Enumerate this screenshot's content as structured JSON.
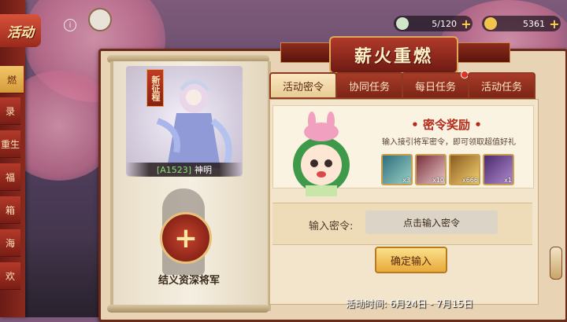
{
  "sidebar": {
    "title": "活动",
    "tabs": [
      "燃",
      "录",
      "重生",
      "福",
      "箱",
      "海",
      "欢"
    ]
  },
  "header": {
    "title": "薪火重燃",
    "info_icon": "info-icon",
    "resources": [
      {
        "value": "5/120",
        "icon": "stamina-icon",
        "color": "#cfe7c8"
      },
      {
        "value": "5361",
        "icon": "gold-ingot-icon",
        "color": "#f2c44e"
      }
    ]
  },
  "scroll": {
    "badge": "新征程",
    "hero_code": "[A1523]",
    "hero_name": "神明",
    "add_label": "结义资深将军"
  },
  "tabs": [
    {
      "label": "活动密令",
      "active": true,
      "dot": false
    },
    {
      "label": "协同任务",
      "active": false,
      "dot": false
    },
    {
      "label": "每日任务",
      "active": false,
      "dot": true
    },
    {
      "label": "活动任务",
      "active": false,
      "dot": false
    }
  ],
  "reward": {
    "title": "密令奖励",
    "description": "输入接引将军密令，即可领取超值好礼",
    "items": [
      {
        "name": "card-item",
        "count": "x3",
        "color": "#2f6f7a"
      },
      {
        "name": "scroll-item",
        "count": "x10",
        "color": "#7a2f3a"
      },
      {
        "name": "gold-item",
        "count": "x666",
        "color": "#c9962e"
      },
      {
        "name": "title-item",
        "count": "x1",
        "color": "#6a3a8a"
      }
    ]
  },
  "password": {
    "label": "输入密令:",
    "placeholder": "点击输入密令",
    "confirm": "确定输入"
  },
  "activity_time": "活动时间: 6月24日 - 7月15日"
}
